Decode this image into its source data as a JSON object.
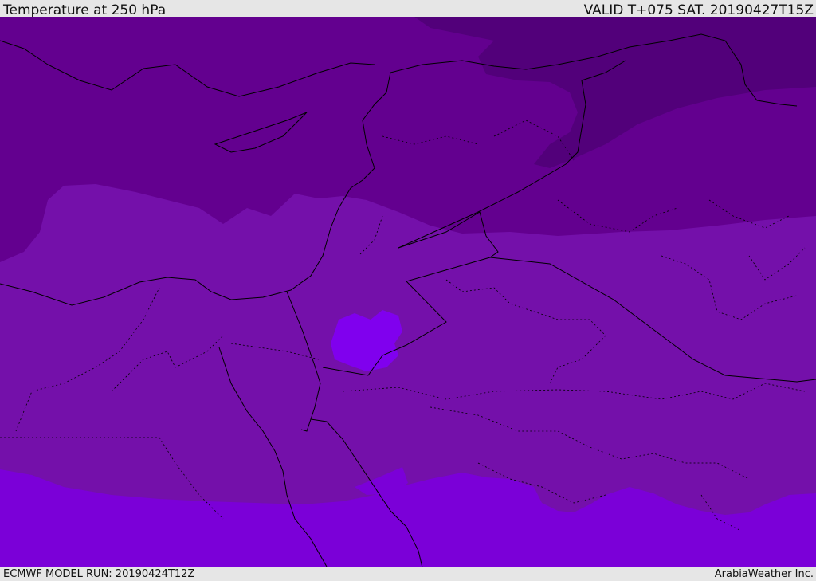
{
  "header": {
    "title": "Temperature at 250 hPa",
    "valid_time": "VALID T+075 SAT. 20190427T15Z"
  },
  "footer": {
    "model_run": "ECMWF MODEL RUN: 20190424T12Z",
    "credit": "ArabiaWeather Inc."
  },
  "map": {
    "field": "Temperature at 250 hPa",
    "colors": {
      "coldest": "#4f007f",
      "cold": "#63008f",
      "mid": "#7410aa",
      "warm": "#7b00d8",
      "warmest_patch": "#8000ee",
      "border_line": "#000000"
    }
  }
}
